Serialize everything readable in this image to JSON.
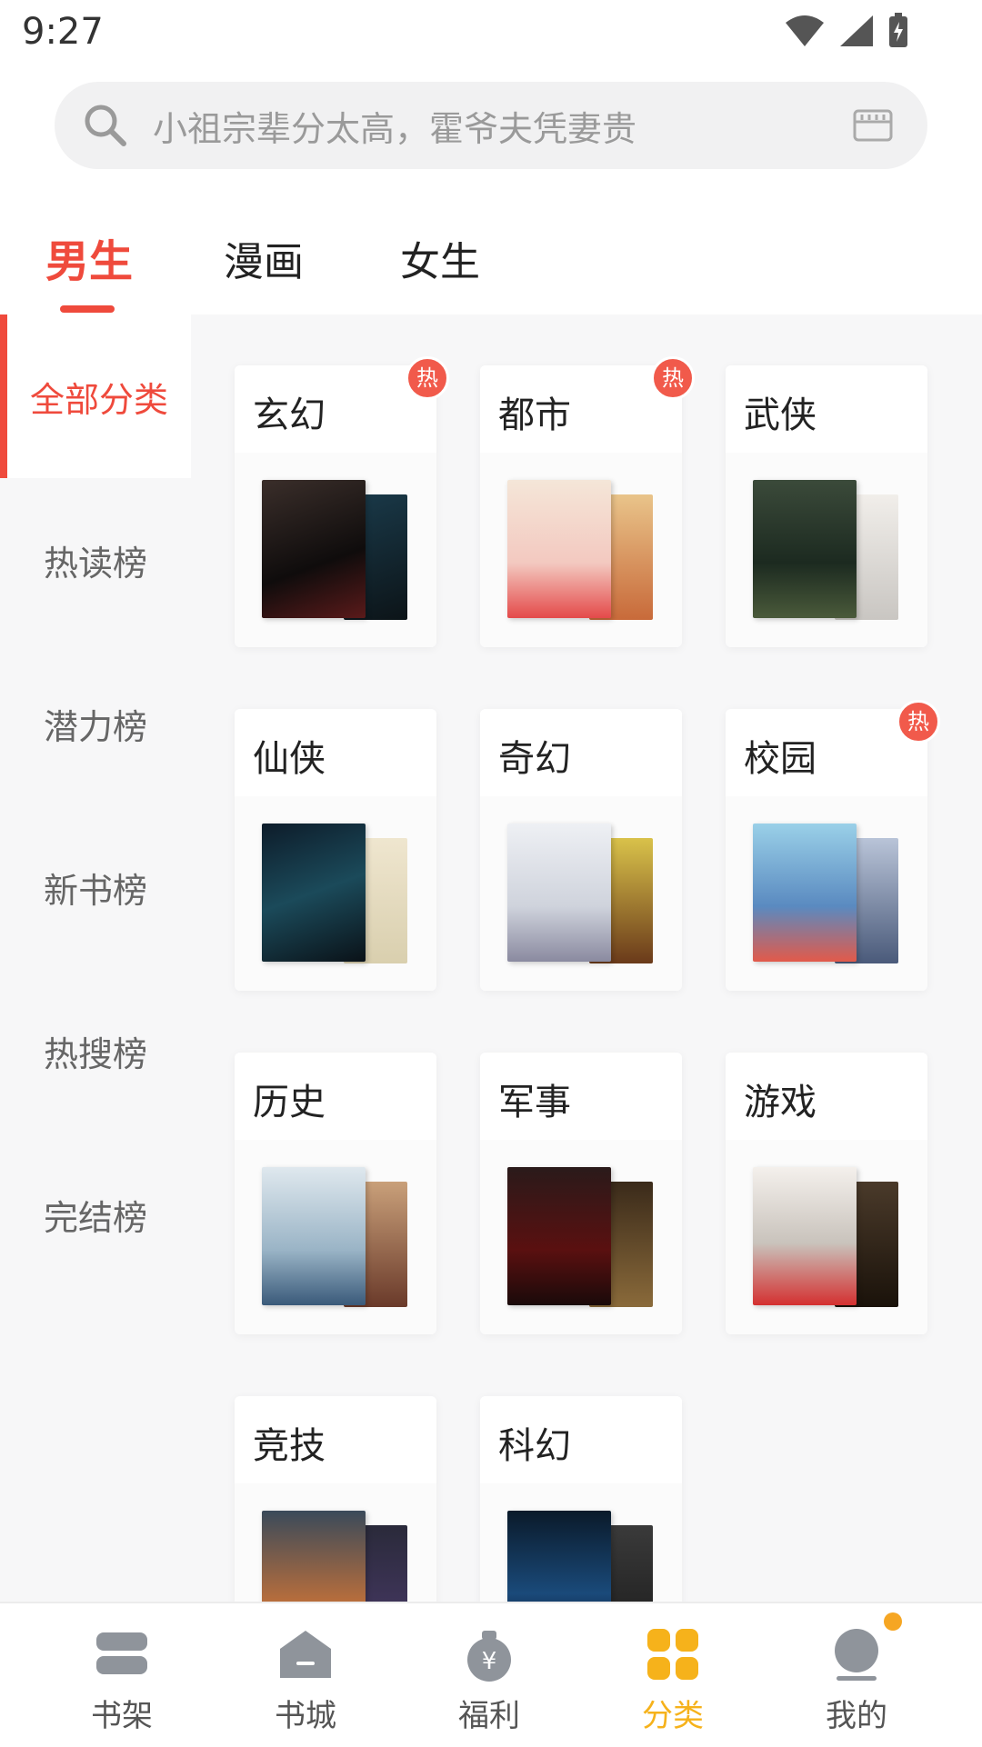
{
  "status": {
    "time": "9:27"
  },
  "search": {
    "placeholder": "小祖宗辈分太高，霍爷夫凭妻贵"
  },
  "tabs": [
    {
      "label": "男生",
      "active": true
    },
    {
      "label": "漫画",
      "active": false
    },
    {
      "label": "女生",
      "active": false
    }
  ],
  "sidebar": {
    "items": [
      {
        "label": "全部分类",
        "active": true
      },
      {
        "label": "热读榜"
      },
      {
        "label": "潜力榜"
      },
      {
        "label": "新书榜"
      },
      {
        "label": "热搜榜"
      },
      {
        "label": "完结榜"
      }
    ]
  },
  "hot_badge": "热",
  "categories": [
    {
      "label": "玄幻",
      "hot": true
    },
    {
      "label": "都市",
      "hot": true
    },
    {
      "label": "武侠",
      "hot": false
    },
    {
      "label": "仙侠",
      "hot": false
    },
    {
      "label": "奇幻",
      "hot": false
    },
    {
      "label": "校园",
      "hot": true
    },
    {
      "label": "历史",
      "hot": false
    },
    {
      "label": "军事",
      "hot": false
    },
    {
      "label": "游戏",
      "hot": false
    },
    {
      "label": "竞技",
      "hot": false
    },
    {
      "label": "科幻",
      "hot": false
    }
  ],
  "bottom_nav": [
    {
      "label": "书架",
      "icon": "bookshelf-icon"
    },
    {
      "label": "书城",
      "icon": "bookstore-icon"
    },
    {
      "label": "福利",
      "icon": "welfare-bag-icon"
    },
    {
      "label": "分类",
      "icon": "category-grid-icon",
      "active": true
    },
    {
      "label": "我的",
      "icon": "profile-icon"
    }
  ],
  "colors": {
    "accent": "#ef4a3c",
    "nav_active": "#f6b21b",
    "hot": "#f15a4b"
  }
}
